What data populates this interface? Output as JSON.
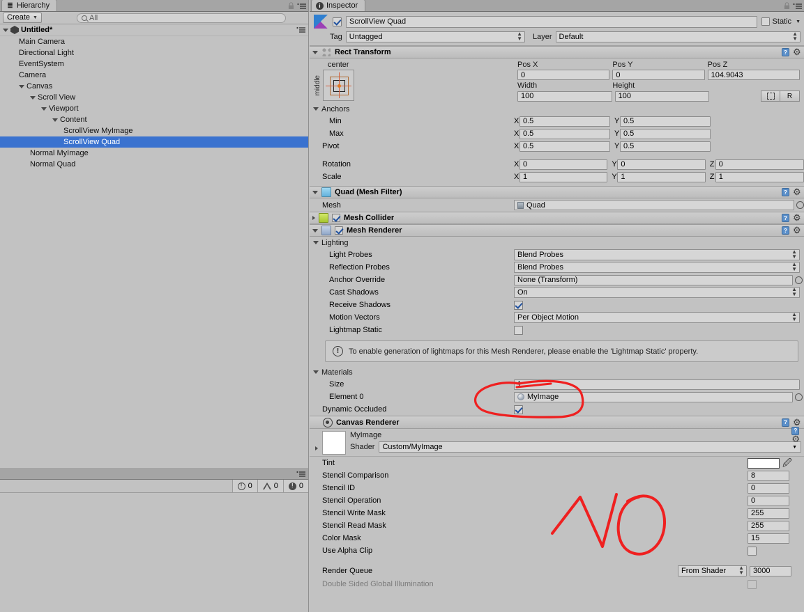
{
  "hierarchy": {
    "tab_label": "Hierarchy",
    "tab_icon": "hierarchy-icon",
    "create_label": "Create",
    "search_placeholder": "All",
    "search_value": "",
    "scene_name": "Untitled*",
    "items": [
      {
        "label": "Main Camera",
        "depth": 1,
        "expandable": false,
        "selected": false
      },
      {
        "label": "Directional Light",
        "depth": 1,
        "expandable": false,
        "selected": false
      },
      {
        "label": "EventSystem",
        "depth": 1,
        "expandable": false,
        "selected": false
      },
      {
        "label": "Camera",
        "depth": 1,
        "expandable": false,
        "selected": false
      },
      {
        "label": "Canvas",
        "depth": 1,
        "expandable": true,
        "selected": false
      },
      {
        "label": "Scroll View",
        "depth": 2,
        "expandable": true,
        "selected": false
      },
      {
        "label": "Viewport",
        "depth": 3,
        "expandable": true,
        "selected": false
      },
      {
        "label": "Content",
        "depth": 4,
        "expandable": true,
        "selected": false
      },
      {
        "label": "ScrollView MyImage",
        "depth": 5,
        "expandable": false,
        "selected": false
      },
      {
        "label": "ScrollView Quad",
        "depth": 5,
        "expandable": false,
        "selected": true
      },
      {
        "label": "Normal MyImage",
        "depth": 2,
        "expandable": false,
        "selected": false
      },
      {
        "label": "Normal Quad",
        "depth": 2,
        "expandable": false,
        "selected": false
      }
    ]
  },
  "console": {
    "info_count": "0",
    "warning_count": "0",
    "error_count": "0"
  },
  "inspector": {
    "tab_label": "Inspector",
    "object_name": "ScrollView Quad",
    "object_enabled": true,
    "static_label": "Static",
    "static_checked": false,
    "tag_label": "Tag",
    "tag_value": "Untagged",
    "layer_label": "Layer",
    "layer_value": "Default",
    "rect_transform": {
      "title": "Rect Transform",
      "anchor_preset_h": "center",
      "anchor_preset_v": "middle",
      "pos_x_label": "Pos X",
      "pos_x": "0",
      "pos_y_label": "Pos Y",
      "pos_y": "0",
      "pos_z_label": "Pos Z",
      "pos_z": "104.9043",
      "width_label": "Width",
      "width": "100",
      "height_label": "Height",
      "height": "100",
      "blueprint_label": "",
      "rawedit_label": "R",
      "anchors_label": "Anchors",
      "min_label": "Min",
      "min_x": "0.5",
      "min_y": "0.5",
      "max_label": "Max",
      "max_x": "0.5",
      "max_y": "0.5",
      "pivot_label": "Pivot",
      "pivot_x": "0.5",
      "pivot_y": "0.5",
      "rotation_label": "Rotation",
      "rot_x": "0",
      "rot_y": "0",
      "rot_z": "0",
      "scale_label": "Scale",
      "scale_x": "1",
      "scale_y": "1",
      "scale_z": "1"
    },
    "mesh_filter": {
      "title": "Quad (Mesh Filter)",
      "mesh_label": "Mesh",
      "mesh_value": "Quad"
    },
    "mesh_collider": {
      "title": "Mesh Collider",
      "enabled": true
    },
    "mesh_renderer": {
      "title": "Mesh Renderer",
      "enabled": true,
      "lighting_label": "Lighting",
      "light_probes_label": "Light Probes",
      "light_probes_value": "Blend Probes",
      "reflection_probes_label": "Reflection Probes",
      "reflection_probes_value": "Blend Probes",
      "anchor_override_label": "Anchor Override",
      "anchor_override_value": "None (Transform)",
      "cast_shadows_label": "Cast Shadows",
      "cast_shadows_value": "On",
      "receive_shadows_label": "Receive Shadows",
      "receive_shadows_checked": true,
      "motion_vectors_label": "Motion Vectors",
      "motion_vectors_value": "Per Object Motion",
      "lightmap_static_label": "Lightmap Static",
      "lightmap_static_checked": false,
      "help_text": "To enable generation of lightmaps for this Mesh Renderer, please enable the 'Lightmap Static' property.",
      "materials_label": "Materials",
      "size_label": "Size",
      "size_value": "1",
      "element0_label": "Element 0",
      "element0_value": "MyImage",
      "dynamic_occluded_label": "Dynamic Occluded",
      "dynamic_occluded_checked": true
    },
    "canvas_renderer": {
      "title": "Canvas Renderer"
    },
    "material": {
      "name": "MyImage",
      "shader_label": "Shader",
      "shader_value": "Custom/MyImage",
      "properties": [
        {
          "label": "Tint",
          "type": "color",
          "value": "#FFFFFF"
        },
        {
          "label": "Stencil Comparison",
          "type": "number",
          "value": "8"
        },
        {
          "label": "Stencil ID",
          "type": "number",
          "value": "0"
        },
        {
          "label": "Stencil Operation",
          "type": "number",
          "value": "0"
        },
        {
          "label": "Stencil Write Mask",
          "type": "number",
          "value": "255"
        },
        {
          "label": "Stencil Read Mask",
          "type": "number",
          "value": "255"
        },
        {
          "label": "Color Mask",
          "type": "number",
          "value": "15"
        },
        {
          "label": "Use Alpha Clip",
          "type": "toggle",
          "value": "false"
        }
      ],
      "render_queue_label": "Render Queue",
      "render_queue_mode": "From Shader",
      "render_queue_value": "3000",
      "double_sided_gi_label": "Double Sided Global Illumination",
      "double_sided_gi_checked": false
    }
  },
  "annotations": {
    "circle_label": "hand-drawn red circle around Materials Element 0",
    "no_label": "NO",
    "color": "#ef2020"
  },
  "colors": {
    "panel_bg": "#c2c2c2",
    "selection_blue": "#3a72cf",
    "field_bg": "#d6d6d6",
    "annotation_red": "#ef2020"
  }
}
